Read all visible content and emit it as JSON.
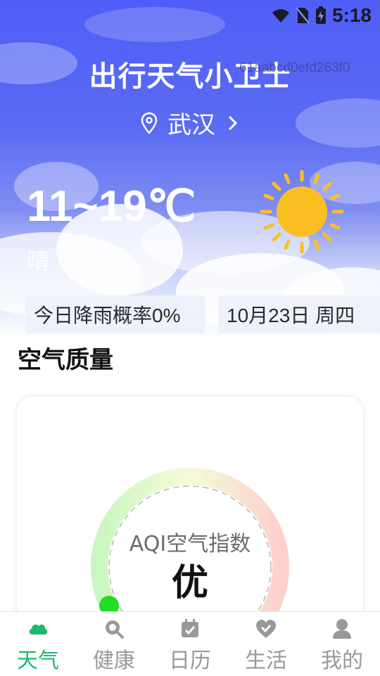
{
  "status_bar": {
    "time": "5:18"
  },
  "header": {
    "title": "出行天气小卫士",
    "overlay_id": "61aabcd0efd263f0",
    "location": "武汉"
  },
  "weather": {
    "temp_range": "11~19℃",
    "condition": "晴",
    "rain_chance": "今日降雨概率0%",
    "date": "10月23日 周四"
  },
  "air_quality": {
    "section_title": "空气质量",
    "aqi_label": "AQI空气指数",
    "level": "优"
  },
  "tabs": [
    {
      "label": "天气",
      "icon": "cloud-icon",
      "active": true
    },
    {
      "label": "健康",
      "icon": "search-health-icon",
      "active": false
    },
    {
      "label": "日历",
      "icon": "calendar-icon",
      "active": false
    },
    {
      "label": "生活",
      "icon": "heart-check-icon",
      "active": false
    },
    {
      "label": "我的",
      "icon": "user-icon",
      "active": false
    }
  ],
  "colors": {
    "hero_blue": "#5a6bf4",
    "active_tab": "#1fb86a",
    "sun": "#fbbf24",
    "gauge_good": "#22dd22"
  }
}
